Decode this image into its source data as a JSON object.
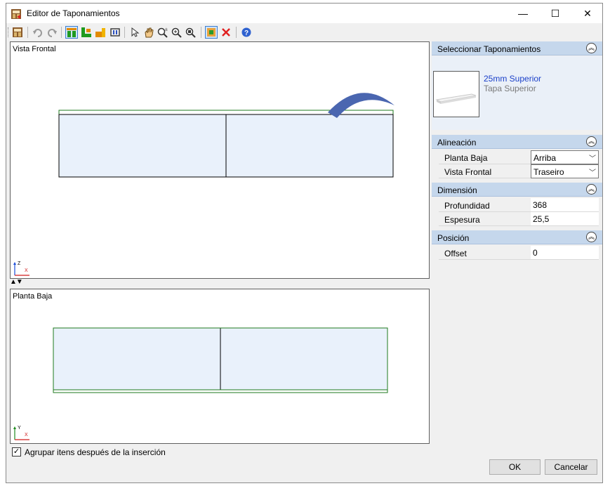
{
  "window": {
    "title": "Editor de Taponamientos",
    "minimize": "—",
    "maximize": "☐",
    "close": "✕"
  },
  "toolbar": {
    "icons": [
      "editor-icon",
      "undo-icon",
      "redo-icon",
      "front-view-icon",
      "top-view-icon",
      "side-view-icon",
      "view-3d-icon",
      "select-icon",
      "pan-icon",
      "zoom-extents-icon",
      "zoom-in-icon",
      "zoom-window-icon",
      "insert-icon",
      "delete-icon",
      "help-icon"
    ]
  },
  "viewports": {
    "front": {
      "label": "Vista Frontal",
      "axis_v": "Z",
      "axis_h": "X"
    },
    "top": {
      "label": "Planta Baja",
      "axis_v": "Y",
      "axis_h": "X"
    },
    "splitter": "▲▼"
  },
  "panel": {
    "select": {
      "header": "Seleccionar Taponamientos",
      "item_title": "25mm Superior",
      "item_subtitle": "Tapa Superior"
    },
    "alineacion": {
      "header": "Alineación",
      "rows": [
        {
          "label": "Planta Baja",
          "value": "Arriba"
        },
        {
          "label": "Vista Frontal",
          "value": "Traseiro"
        }
      ]
    },
    "dimension": {
      "header": "Dimensión",
      "rows": [
        {
          "label": "Profundidad",
          "value": "368"
        },
        {
          "label": "Espesura",
          "value": "25,5"
        }
      ]
    },
    "posicion": {
      "header": "Posición",
      "rows": [
        {
          "label": "Offset",
          "value": "0"
        }
      ]
    }
  },
  "footer": {
    "group_checkbox": "Agrupar itens después de la inserción",
    "group_checked": true,
    "ok": "OK",
    "cancel": "Cancelar"
  },
  "colors": {
    "section_header": "#c5d7ec",
    "panel_fill": "#eaf0f8",
    "outline_green": "#1e7a1e",
    "arrow_blue": "#4a66b0"
  }
}
